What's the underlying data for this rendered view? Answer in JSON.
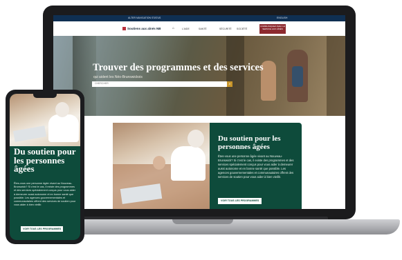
{
  "laptop": {
    "topbar": {
      "left_text": "ALTER NAVIGATION STATUS",
      "right_text": "ENGLISH"
    },
    "nav": {
      "logo": "Soutiens aux aînés NB",
      "links": [
        "L'AIDE",
        "SANTÉ",
        "SÉCURITÉ",
        "SOCIÉTÉ",
        "CONTACTEZ-NOUS"
      ],
      "cta": "COMMUNIQUEZ AVEC LE SERVICE AUX AÎNÉS"
    },
    "hero": {
      "title": "Trouver des programmes et des services",
      "subtitle": "qui aident les Néo-Brunswickois",
      "search_placeholder": "CHERCHER"
    },
    "feature": {
      "title": "Du soutien pour les personnes âgées",
      "text": "Êtes-vous une personne âgée vivant au Nouveau-Brunswick? Si c'est le cas, il existe des programmes et des services spécialement conçus pour vous aider à demeurer aussi autonome et en bonne santé que possible. Les agences gouvernementales et communautaires offrent des services de soutien pour vous aider à bien vieillir.",
      "button": "VOIR TOUS LES PROGRAMMES"
    }
  },
  "phone": {
    "title": "Du soutien pour les personnes âgées",
    "text": "Êtes-vous une personne âgée vivant au Nouveau-Brunswick? Si c'est le cas, il existe des programmes et des services spécialement conçus pour vous aider à demeurer aussi autonome et en bonne santé que possible. Les agences gouvernementales et communautaires offrent des services de soutien pour vous aider à bien vieillir.",
    "button": "VOIR TOUS LES PROGRAMMES"
  }
}
